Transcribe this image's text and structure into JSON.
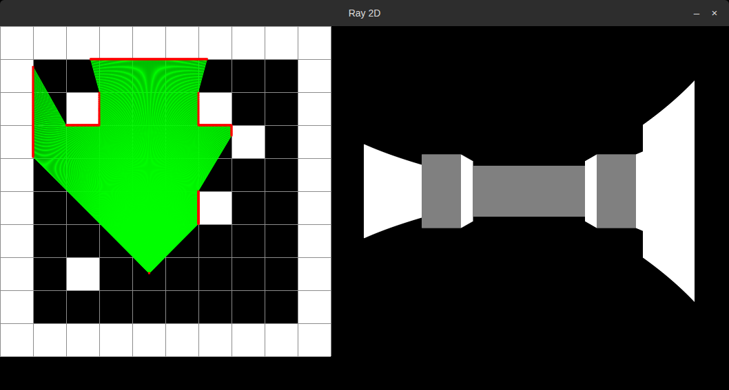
{
  "window": {
    "title": "Ray 2D",
    "buttons": [
      "–",
      "×"
    ]
  },
  "map": [
    "1111111111",
    "1000000001",
    "1010001001",
    "1000000101",
    "1000000001",
    "1000001001",
    "1000000001",
    "1010000001",
    "1000000001",
    "1111111111"
  ],
  "camera": {
    "x": 4.51,
    "y": 7.48,
    "angle": -90,
    "fov": 90,
    "rays": 480
  }
}
